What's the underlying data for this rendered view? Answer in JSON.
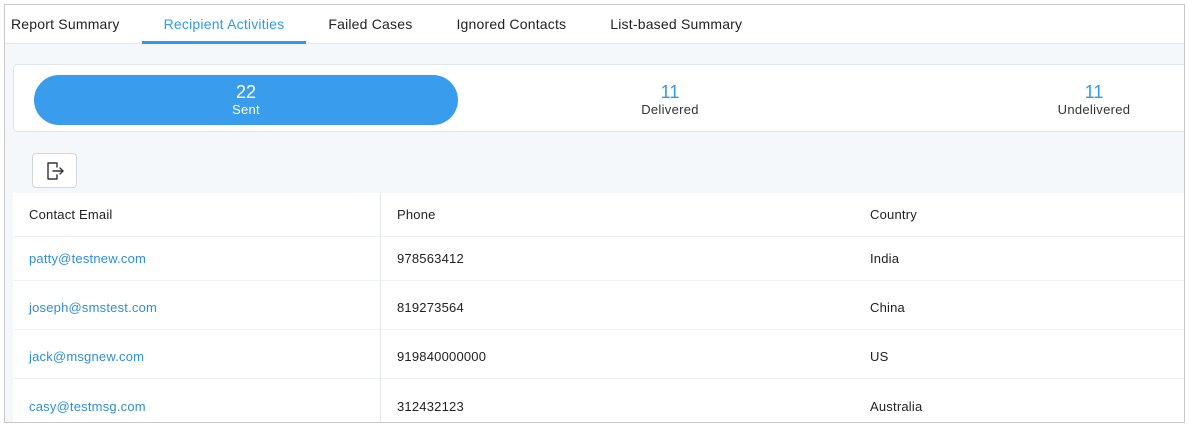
{
  "tabs": [
    {
      "label": "Report Summary",
      "active": false
    },
    {
      "label": "Recipient Activities",
      "active": true
    },
    {
      "label": "Failed Cases",
      "active": false
    },
    {
      "label": "Ignored Contacts",
      "active": false
    },
    {
      "label": "List-based Summary",
      "active": false
    }
  ],
  "stats": {
    "sent": {
      "count": "22",
      "label": "Sent"
    },
    "delivered": {
      "count": "11",
      "label": "Delivered"
    },
    "undelivered": {
      "count": "11",
      "label": "Undelivered"
    }
  },
  "toolbar": {
    "export_icon": "export-icon"
  },
  "table": {
    "headers": {
      "email": "Contact Email",
      "phone": "Phone",
      "country": "Country"
    },
    "rows": [
      {
        "email": "patty@testnew.com",
        "phone": "978563412",
        "country": "India"
      },
      {
        "email": "joseph@smstest.com",
        "phone": "819273564",
        "country": "China"
      },
      {
        "email": "jack@msgnew.com",
        "phone": "919840000000",
        "country": "US"
      },
      {
        "email": "casy@testmsg.com",
        "phone": "312432123",
        "country": "Australia"
      }
    ]
  },
  "colors": {
    "accent": "#3a9ced",
    "link": "#2f8fd8",
    "background": "#f4f8fb"
  }
}
